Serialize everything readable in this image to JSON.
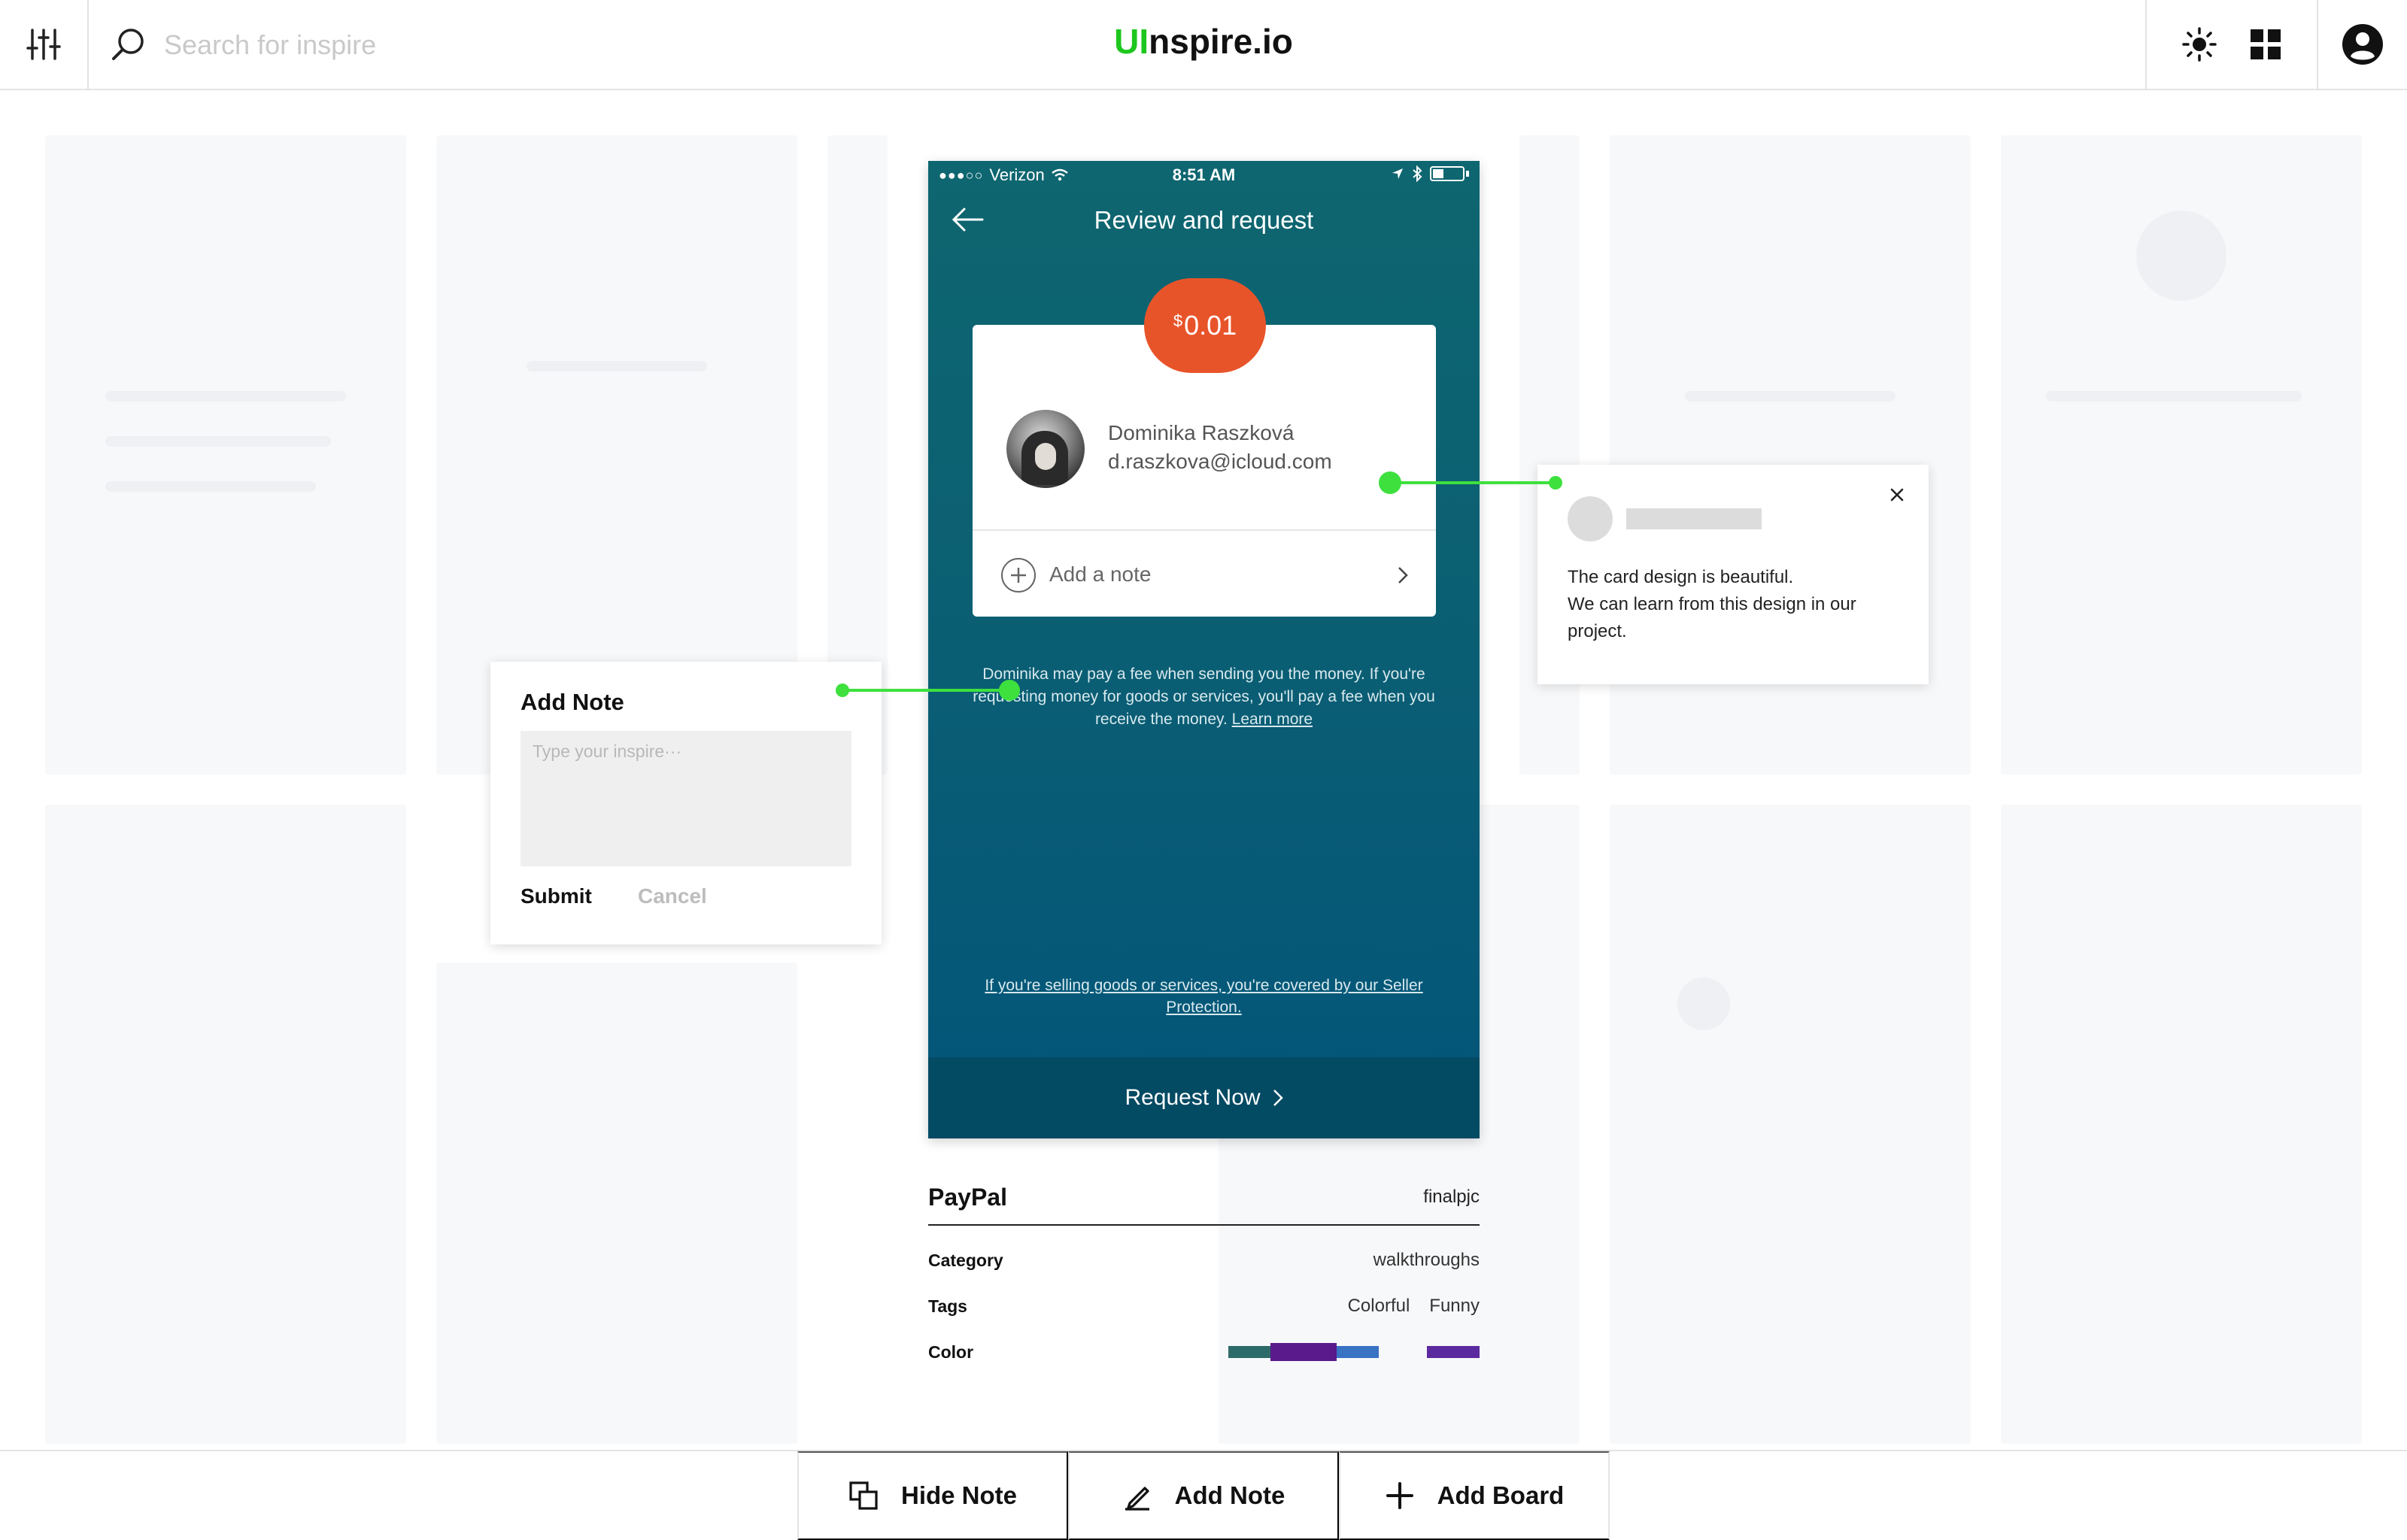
{
  "topbar": {
    "search_placeholder": "Search for inspire",
    "logo_accent": "UI",
    "logo_rest": "nspire.io"
  },
  "phone": {
    "status": {
      "signal": "●●●○○",
      "carrier": "Verizon",
      "time": "8:51 AM"
    },
    "title": "Review and request",
    "amount_currency": "$",
    "amount_value": "0.01",
    "recipient_name": "Dominika Raszková",
    "recipient_email": "d.raszkova@icloud.com",
    "add_note_label": "Add a note",
    "fee_text": "Dominika may pay a fee when sending you the money. If you're requesting money for goods or services, you'll pay a fee when you receive the money.",
    "learn_more": "Learn more",
    "seller_text": "If you're selling goods or services, you're covered by our Seller Protection.",
    "request_button": "Request Now"
  },
  "info": {
    "app_name": "PayPal",
    "author": "finalpjc",
    "category_label": "Category",
    "category_value": "walkthroughs",
    "tags_label": "Tags",
    "tags": [
      "Colorful",
      "Funny"
    ],
    "color_label": "Color",
    "colors": [
      "#2d6b6a",
      "#5b1a8c",
      "#3a72c4",
      "#5b2a9e"
    ]
  },
  "note_panel": {
    "title": "Add Note",
    "placeholder": "Type your inspire···",
    "submit": "Submit",
    "cancel": "Cancel"
  },
  "comment": {
    "text": "The card design is beautiful.\nWe can learn from this design in our project."
  },
  "bottombar": {
    "hide_note": "Hide Note",
    "add_note": "Add Note",
    "add_board": "Add Board"
  },
  "theme": {
    "accent": "#1ec71e",
    "connector": "#3ee03e",
    "amount_bg": "#e8542a",
    "phone_top": "#0e6670",
    "phone_bottom": "#03557a"
  }
}
